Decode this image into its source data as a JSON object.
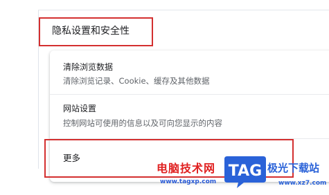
{
  "section": {
    "title": "隐私设置和安全性"
  },
  "items": [
    {
      "title": "清除浏览数据",
      "subtitle": "清除浏览记录、Cookie、缓存及其他数据"
    },
    {
      "title": "网站设置",
      "subtitle": "控制网站可使用的信息以及可向您显示的内容"
    },
    {
      "title": "更多"
    }
  ],
  "watermark": {
    "left_text": "电脑技术网",
    "left_url": "www.tagxp.com",
    "logo_text": "TAG",
    "right_text": "极光下载站",
    "right_url": "www.xz7.com"
  },
  "colors": {
    "highlight": "#d32f2f",
    "watermark_red": "#e02020",
    "watermark_blue": "#2a62d8"
  }
}
